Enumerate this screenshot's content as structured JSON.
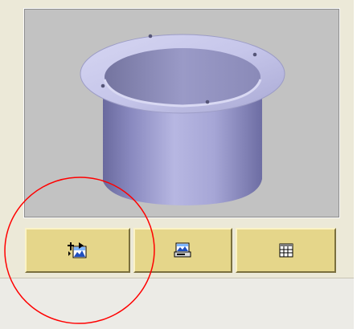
{
  "preview": {
    "description_icon": "cylinder-with-flange-3d-model",
    "background": "#c2c2c2",
    "model_color": "#a8a8d6"
  },
  "toolbar": {
    "buttons": [
      {
        "icon": "insert-image-icon",
        "accent": "#e5d68a"
      },
      {
        "icon": "print-preview-icon",
        "accent": "#e5d68a"
      },
      {
        "icon": "table-view-icon",
        "accent": "#e5d68a"
      }
    ]
  },
  "annotation": {
    "shape": "circle",
    "color": "#ff0000"
  }
}
